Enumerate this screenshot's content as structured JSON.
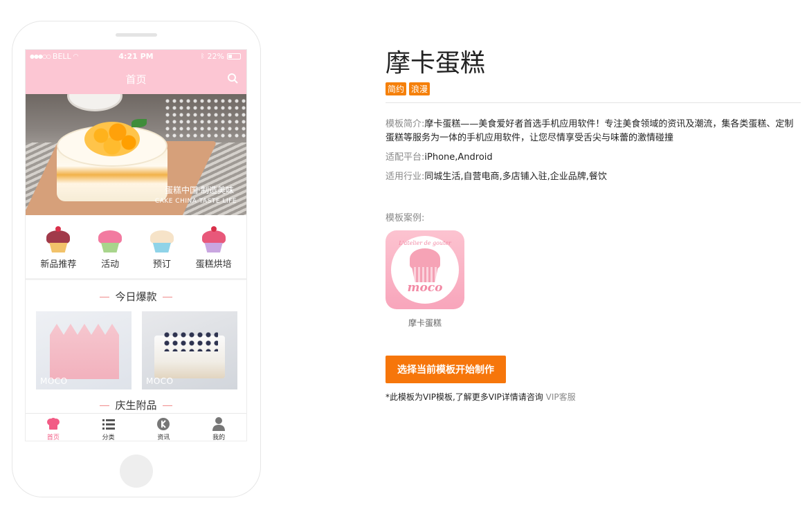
{
  "phone": {
    "status": {
      "carrier": "BELL",
      "time": "4:21 PM",
      "battery": "22%"
    },
    "nav_title": "首页",
    "banner": {
      "caption_cn": "蛋糕中国·制造美味",
      "caption_en": "CAKE CHINA TASTE LIFE"
    },
    "categories": [
      {
        "label": "新品推荐",
        "icon": "cupcake-cherry-icon",
        "frost": "#a13a4a",
        "cup": "#f2c26a"
      },
      {
        "label": "活动",
        "icon": "cupcake-pink-icon",
        "frost": "#f27aa0",
        "cup": "#a8d58c"
      },
      {
        "label": "预订",
        "icon": "cupcake-cream-icon",
        "frost": "#f6e3c8",
        "cup": "#8fd3e8"
      },
      {
        "label": "蛋糕烘培",
        "icon": "cupcake-berry-icon",
        "frost": "#e8587a",
        "cup": "#c9a6e0"
      }
    ],
    "section1": "今日爆款",
    "products": [
      {
        "label": "MOCO"
      },
      {
        "label": "MOCO"
      }
    ],
    "section2": "庆生附品",
    "tabs": [
      {
        "label": "首页",
        "icon": "home-chef-hat-icon",
        "active": true
      },
      {
        "label": "分类",
        "icon": "list-icon",
        "active": false
      },
      {
        "label": "资讯",
        "icon": "news-icon",
        "active": false
      },
      {
        "label": "我的",
        "icon": "user-icon",
        "active": false
      }
    ]
  },
  "detail": {
    "title": "摩卡蛋糕",
    "tags": [
      "简约",
      "浪漫"
    ],
    "intro_label": "模板简介:",
    "intro_text": "摩卡蛋糕——美食爱好者首选手机应用软件！专注美食领域的资讯及潮流，集各类蛋糕、定制蛋糕等服务为一体的手机应用软件，让您尽情享受舌尖与味蕾的激情碰撞",
    "platform_label": "适配平台:",
    "platform_text": "iPhone,Android",
    "industry_label": "适用行业:",
    "industry_text": "同城生活,自营电商,多店铺入驻,企业品牌,餐饮",
    "cases_label": "模板案例:",
    "case": {
      "name": "摩卡蛋糕",
      "logo_text": "moco",
      "logo_arc": "L'atelier de gouter"
    },
    "cta": "选择当前模板开始制作",
    "note_text": "*此模板为VIP模板,了解更多VIP详情请咨询",
    "note_link": "VIP客服"
  },
  "colors": {
    "brand_pink": "#fcc6d3",
    "accent_orange": "#f6760b",
    "tab_active": "#f25b85"
  }
}
